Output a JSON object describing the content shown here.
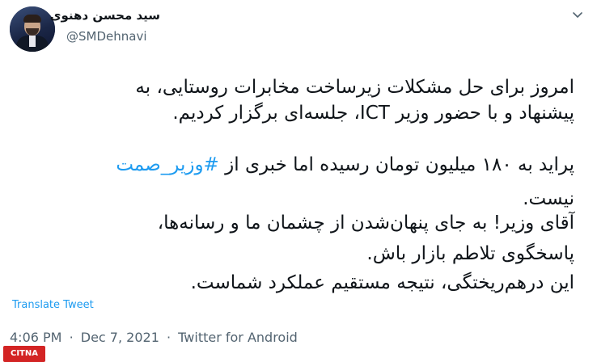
{
  "author": {
    "display_name": "سید محسن دهنوی",
    "handle": "@SMDehnavi"
  },
  "icons": {
    "more": "chevron-down-icon",
    "avatar": "avatar"
  },
  "tweet": {
    "line1": "امروز برای حل مشکلات زیرساخت مخابرات روستایی، به",
    "line2": "پیشنهاد و با حضور وزیر ICT، جلسه‌ای برگزار کردیم.",
    "line3_before": "پراید به ۱۸۰ میلیون تومان رسیده اما خبری از ",
    "hashtag": "#وزیر_صمت",
    "line4": "نیست.",
    "line5": "آقای وزیر! به جای پنهان‌شدن از چشمان ما و رسانه‌ها،",
    "line6": "پاسخگوی تلاطم بازار باش.",
    "line7": "این درهم‌ریختگی، نتیجه مستقیم عملکرد شماست."
  },
  "translate_label": "Translate Tweet",
  "meta": {
    "time": "4:06 PM",
    "sep1": "·",
    "date": "Dec 7, 2021",
    "sep2": "·",
    "source": "Twitter for Android"
  },
  "watermark": "CITNA",
  "colors": {
    "link": "#1d9bf0",
    "muted": "#536471",
    "text": "#0f1419"
  }
}
